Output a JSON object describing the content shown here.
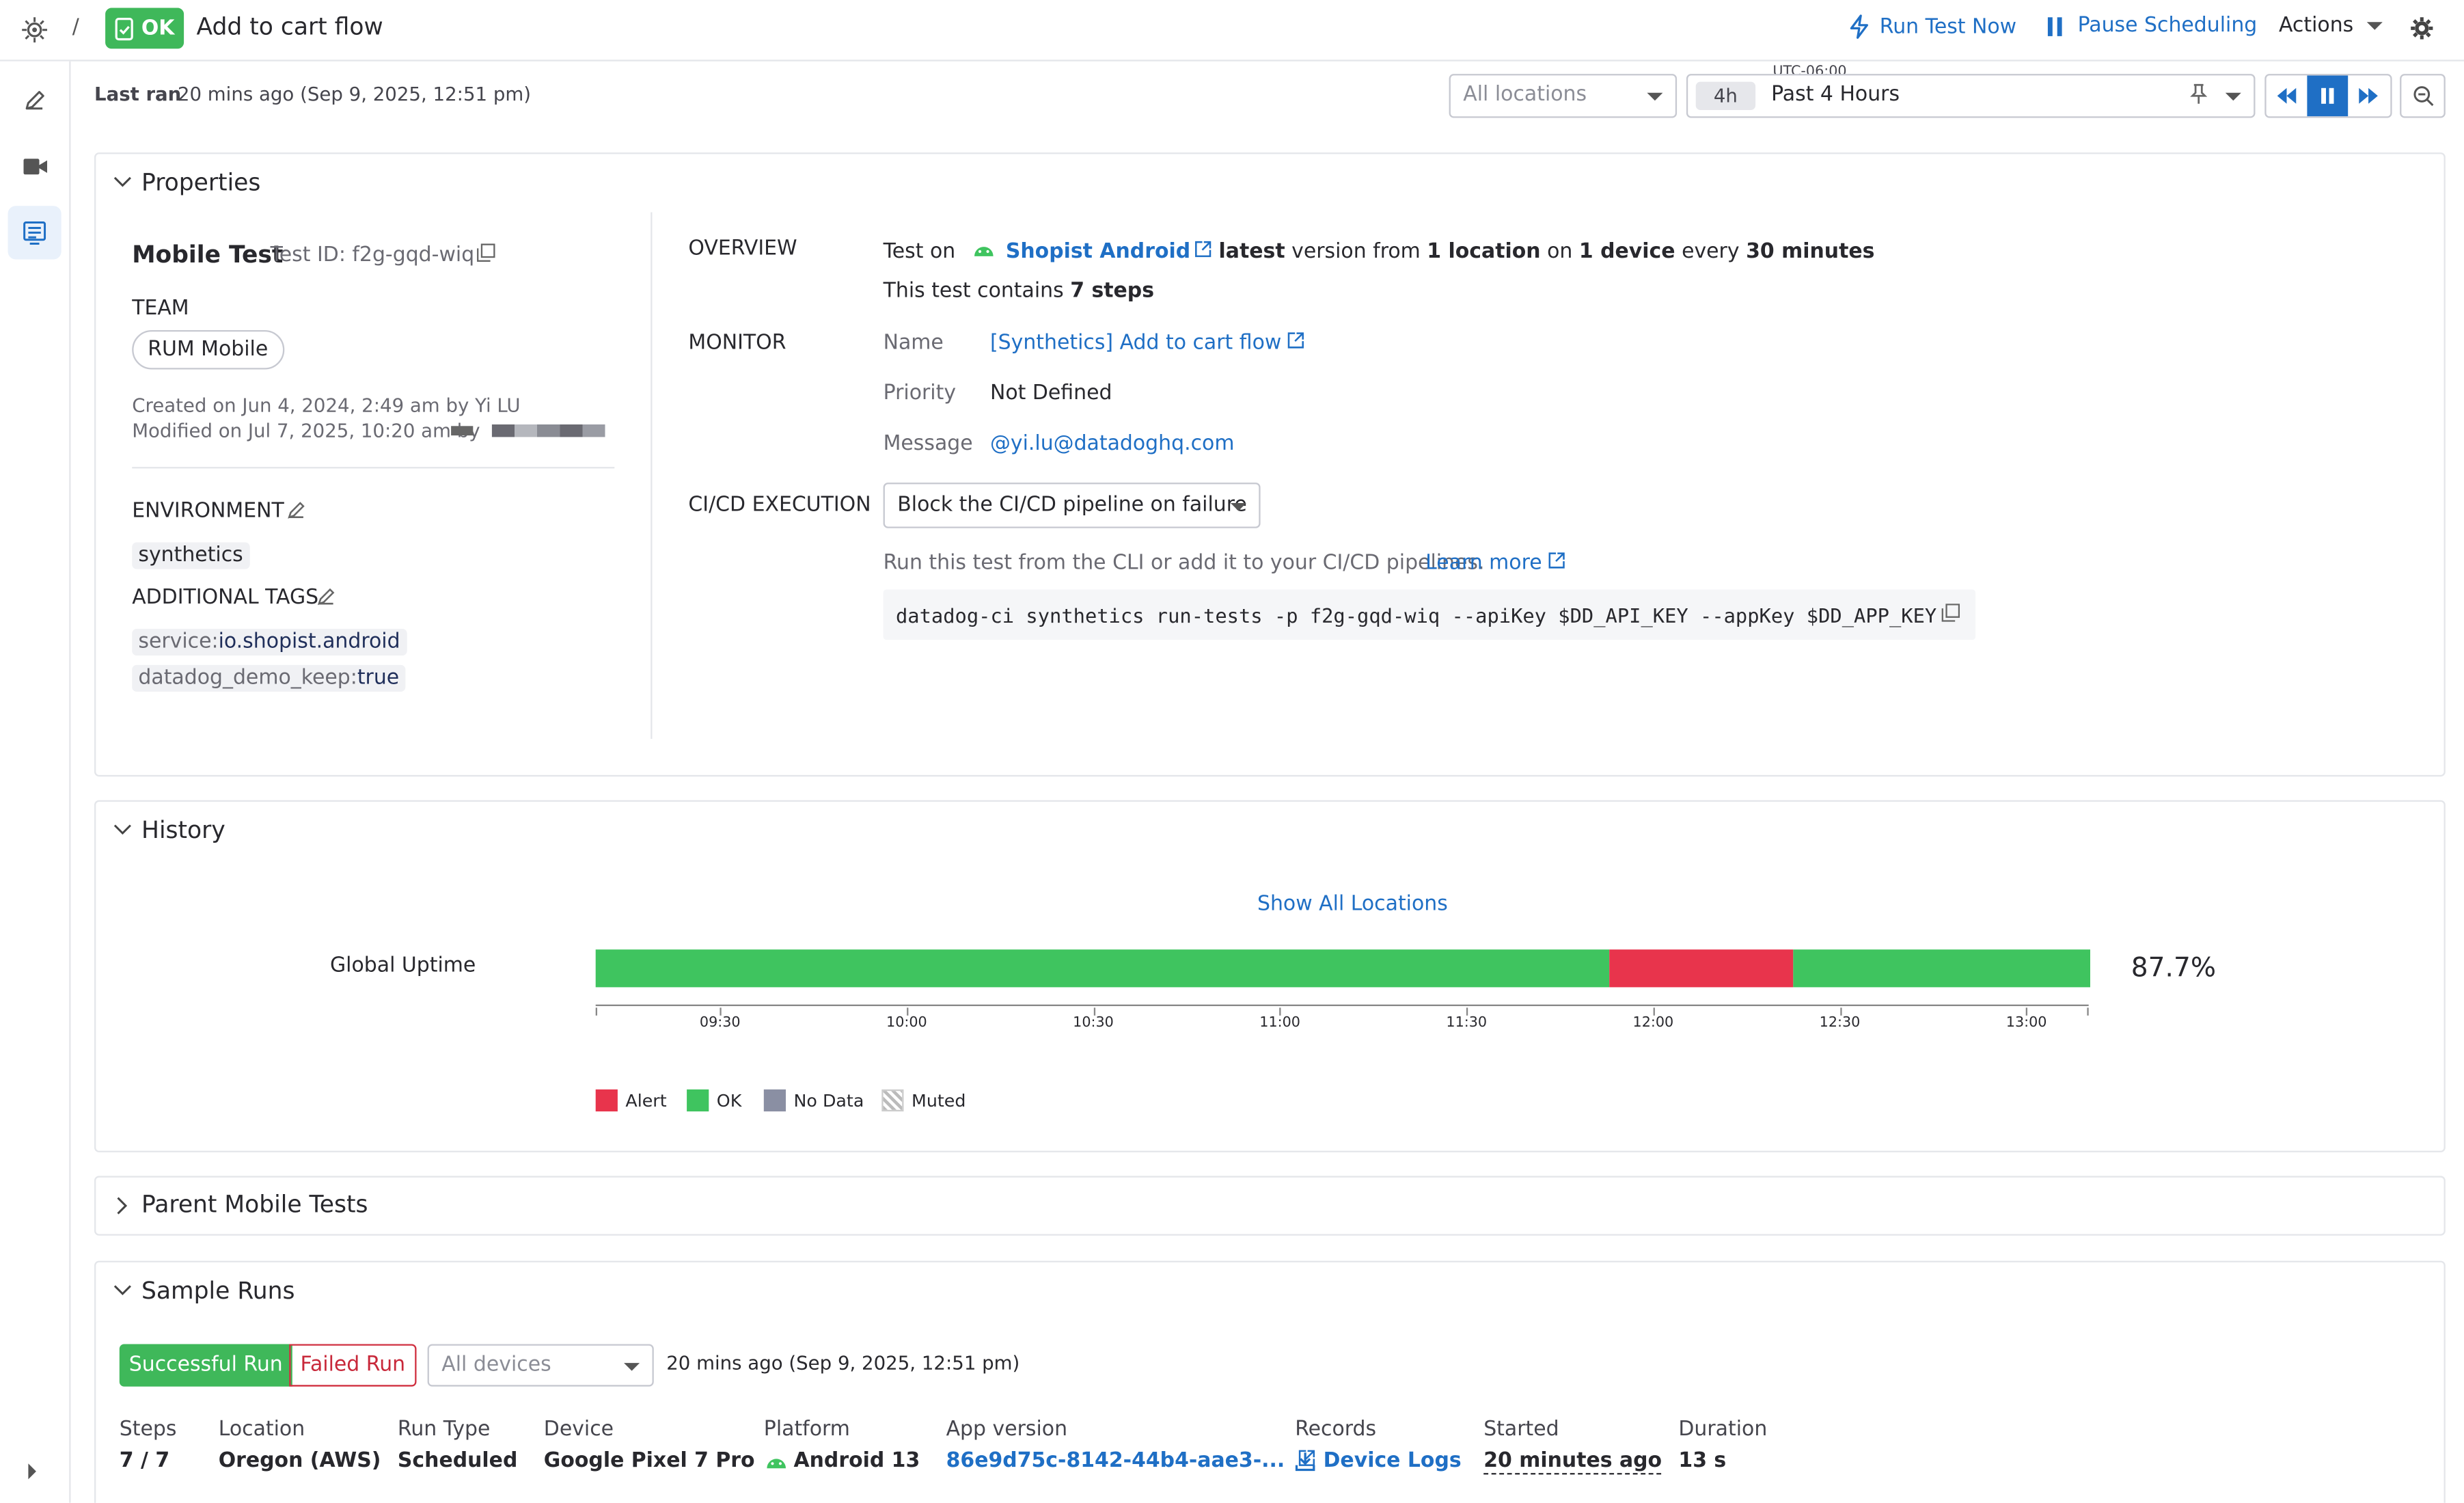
{
  "colors": {
    "ok": "#3fc45f",
    "alert": "#e8344c",
    "no_data": "#8a8fa3",
    "link": "#1f6fc5"
  },
  "header": {
    "breadcrumb_sep": "/",
    "status": "OK",
    "title": "Add to cart flow",
    "run_now": "Run Test Now",
    "pause": "Pause Scheduling",
    "actions": "Actions"
  },
  "toolbar": {
    "last_ran_label": "Last ran",
    "last_ran_value": "20 mins ago (Sep 9, 2025, 12:51 pm)",
    "locations_placeholder": "All locations",
    "timezone": "UTC-06:00",
    "time_badge": "4h",
    "time_range": "Past 4 Hours"
  },
  "properties": {
    "title": "Properties",
    "test_type": "Mobile Test",
    "test_id": "Test ID: f2g-gqd-wiq",
    "team_label": "TEAM",
    "team": "RUM Mobile",
    "created": "Created on Jun 4, 2024, 2:49 am by Yi LU",
    "modified": "Modified on Jul 7, 2025, 10:20 am by",
    "environment_label": "ENVIRONMENT",
    "environment": "synthetics",
    "tags_label": "ADDITIONAL TAGS",
    "tags": [
      {
        "key": "service:",
        "value": "io.shopist.android"
      },
      {
        "key": "datadog_demo_keep:",
        "value": "true"
      }
    ],
    "overview_label": "OVERVIEW",
    "overview_test_on": "Test on",
    "overview_app": "Shopist Android",
    "overview_latest": "latest",
    "overview_version_from": "version from",
    "overview_locations": "1 location",
    "overview_on": "on",
    "overview_devices": "1 device",
    "overview_every": "every",
    "overview_interval": "30 minutes",
    "overview_contains": "This test contains",
    "overview_steps": "7 steps",
    "monitor_label": "MONITOR",
    "monitor_name_label": "Name",
    "monitor_name": "[Synthetics] Add to cart flow",
    "monitor_priority_label": "Priority",
    "monitor_priority": "Not Defined",
    "monitor_message_label": "Message",
    "monitor_message": "@yi.lu@datadoghq.com",
    "cicd_label": "CI/CD EXECUTION",
    "cicd_select": "Block the CI/CD pipeline on failure",
    "cicd_hint": "Run this test from the CLI or add it to your CI/CD pipelines.",
    "learn_more": "Learn more",
    "cli_command": "datadog-ci synthetics run-tests -p f2g-gqd-wiq --apiKey $DD_API_KEY --appKey $DD_APP_KEY"
  },
  "history": {
    "title": "History",
    "show_all": "Show All Locations",
    "row_label": "Global Uptime",
    "uptime": "87.7%",
    "ticks": [
      "09:30",
      "10:00",
      "10:30",
      "11:00",
      "11:30",
      "12:00",
      "12:30",
      "13:00"
    ],
    "segments": [
      {
        "status": "ok",
        "fraction": 0.678
      },
      {
        "status": "alert",
        "fraction": 0.123
      },
      {
        "status": "ok",
        "fraction": 0.199
      }
    ],
    "legend": [
      "Alert",
      "OK",
      "No Data",
      "Muted"
    ]
  },
  "parent_tests": {
    "title": "Parent Mobile Tests"
  },
  "sample_runs": {
    "title": "Sample Runs",
    "tab_success": "Successful Run",
    "tab_failed": "Failed Run",
    "devices_placeholder": "All devices",
    "run_time": "20 mins ago (Sep 9, 2025, 12:51 pm)",
    "columns": [
      {
        "header": "Steps",
        "value": "7 / 7"
      },
      {
        "header": "Location",
        "value": "Oregon (AWS)"
      },
      {
        "header": "Run Type",
        "value": "Scheduled"
      },
      {
        "header": "Device",
        "value": "Google Pixel 7 Pro"
      },
      {
        "header": "Platform",
        "value": "Android 13"
      },
      {
        "header": "App version",
        "value": "86e9d75c-8142-44b4-aae3-..."
      },
      {
        "header": "Records",
        "value": "Device Logs"
      },
      {
        "header": "Started",
        "value": "20 minutes ago"
      },
      {
        "header": "Duration",
        "value": "13 s"
      }
    ]
  }
}
